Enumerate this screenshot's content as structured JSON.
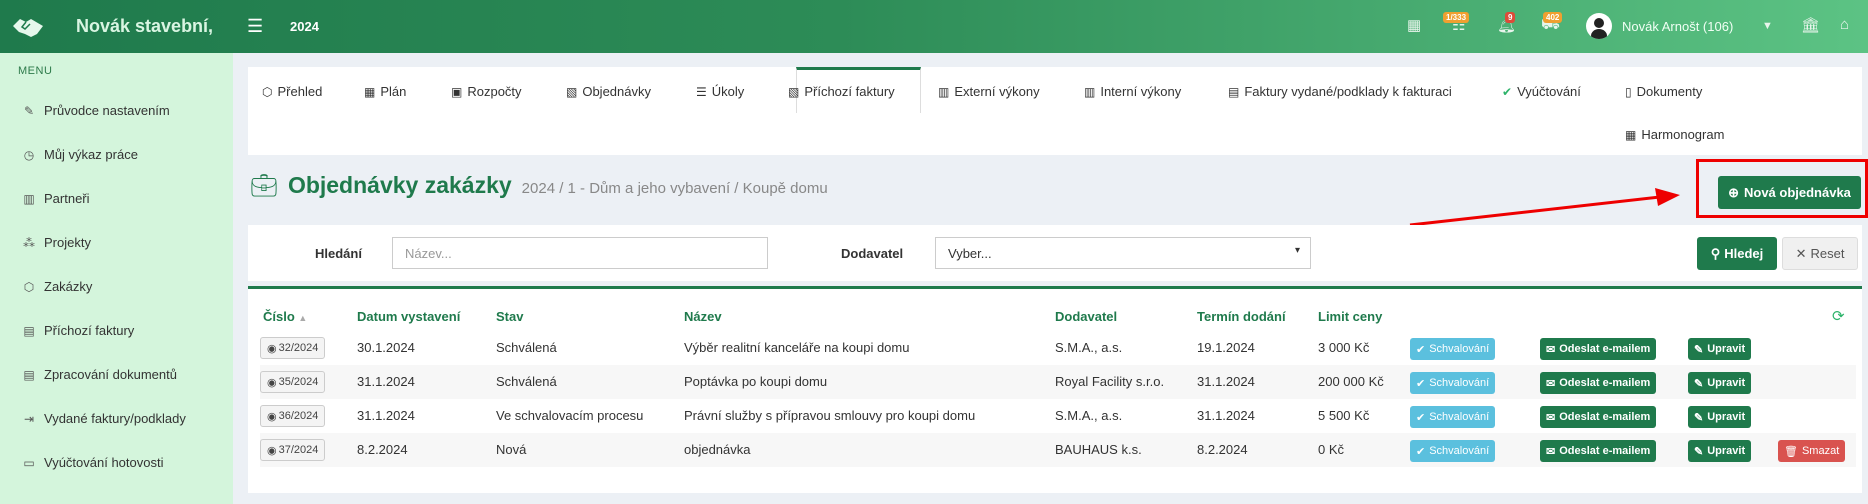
{
  "header": {
    "logo_text": "Novák stavební,",
    "year": "2024",
    "badges": {
      "tasks": "1/333",
      "notifications": "9",
      "messages": "402"
    },
    "user_name": "Novák Arnošt (106)"
  },
  "sidebar": {
    "menu_title": "MENU",
    "items": [
      {
        "label": "Průvodce nastavením",
        "icon": "pencil-icon"
      },
      {
        "label": "Můj výkaz práce",
        "icon": "clock-icon"
      },
      {
        "label": "Partneři",
        "icon": "building-icon"
      },
      {
        "label": "Projekty",
        "icon": "cubes-icon"
      },
      {
        "label": "Zakázky",
        "icon": "cube-icon"
      },
      {
        "label": "Příchozí faktury",
        "icon": "file-icon"
      },
      {
        "label": "Zpracování dokumentů",
        "icon": "file-text-icon"
      },
      {
        "label": "Vydané faktury/podklady",
        "icon": "sign-out-icon"
      },
      {
        "label": "Vyúčtování hotovosti",
        "icon": "money-icon"
      }
    ]
  },
  "tabs": [
    {
      "label": "Přehled"
    },
    {
      "label": "Plán"
    },
    {
      "label": "Rozpočty"
    },
    {
      "label": "Objednávky"
    },
    {
      "label": "Úkoly"
    },
    {
      "label": "Příchozí faktury"
    },
    {
      "label": "Externí výkony"
    },
    {
      "label": "Interní výkony"
    },
    {
      "label": "Faktury vydané/podklady k fakturaci"
    },
    {
      "label": "Vyúčtování"
    },
    {
      "label": "Dokumenty"
    },
    {
      "label": "Harmonogram"
    }
  ],
  "page": {
    "title": "Objednávky zakázky",
    "subtitle": "2024 / 1 - Dům a jeho vybavení / Koupě domu",
    "new_button": "Nová objednávka"
  },
  "search": {
    "label_search": "Hledání",
    "placeholder_search": "Název...",
    "label_supplier": "Dodavatel",
    "supplier_value": "Vyber...",
    "search_button": "Hledej",
    "reset_button": "Reset"
  },
  "table": {
    "columns": [
      "Číslo",
      "Datum vystavení",
      "Stav",
      "Název",
      "Dodavatel",
      "Termín dodání",
      "Limit ceny"
    ],
    "actions": {
      "approve": "Schvalování",
      "email": "Odeslat e-mailem",
      "edit": "Upravit",
      "delete": "Smazat"
    },
    "rows": [
      {
        "number": "32/2024",
        "date": "30.1.2024",
        "status": "Schválená",
        "name": "Výběr realitní kanceláře na koupi domu",
        "supplier": "S.M.A., a.s.",
        "due": "19.1.2024",
        "limit": "3 000 Kč"
      },
      {
        "number": "35/2024",
        "date": "31.1.2024",
        "status": "Schválená",
        "name": "Poptávka po koupi domu",
        "supplier": "Royal Facility s.r.o.",
        "due": "31.1.2024",
        "limit": "200 000 Kč"
      },
      {
        "number": "36/2024",
        "date": "31.1.2024",
        "status": "Ve schvalovacím procesu",
        "name": "Právní služby s přípravou smlouvy pro koupi domu",
        "supplier": "S.M.A., a.s.",
        "due": "31.1.2024",
        "limit": "5 500 Kč"
      },
      {
        "number": "37/2024",
        "date": "8.2.2024",
        "status": "Nová",
        "name": "objednávka",
        "supplier": "BAUHAUS k.s.",
        "due": "8.2.2024",
        "limit": "0 Kč"
      }
    ]
  }
}
